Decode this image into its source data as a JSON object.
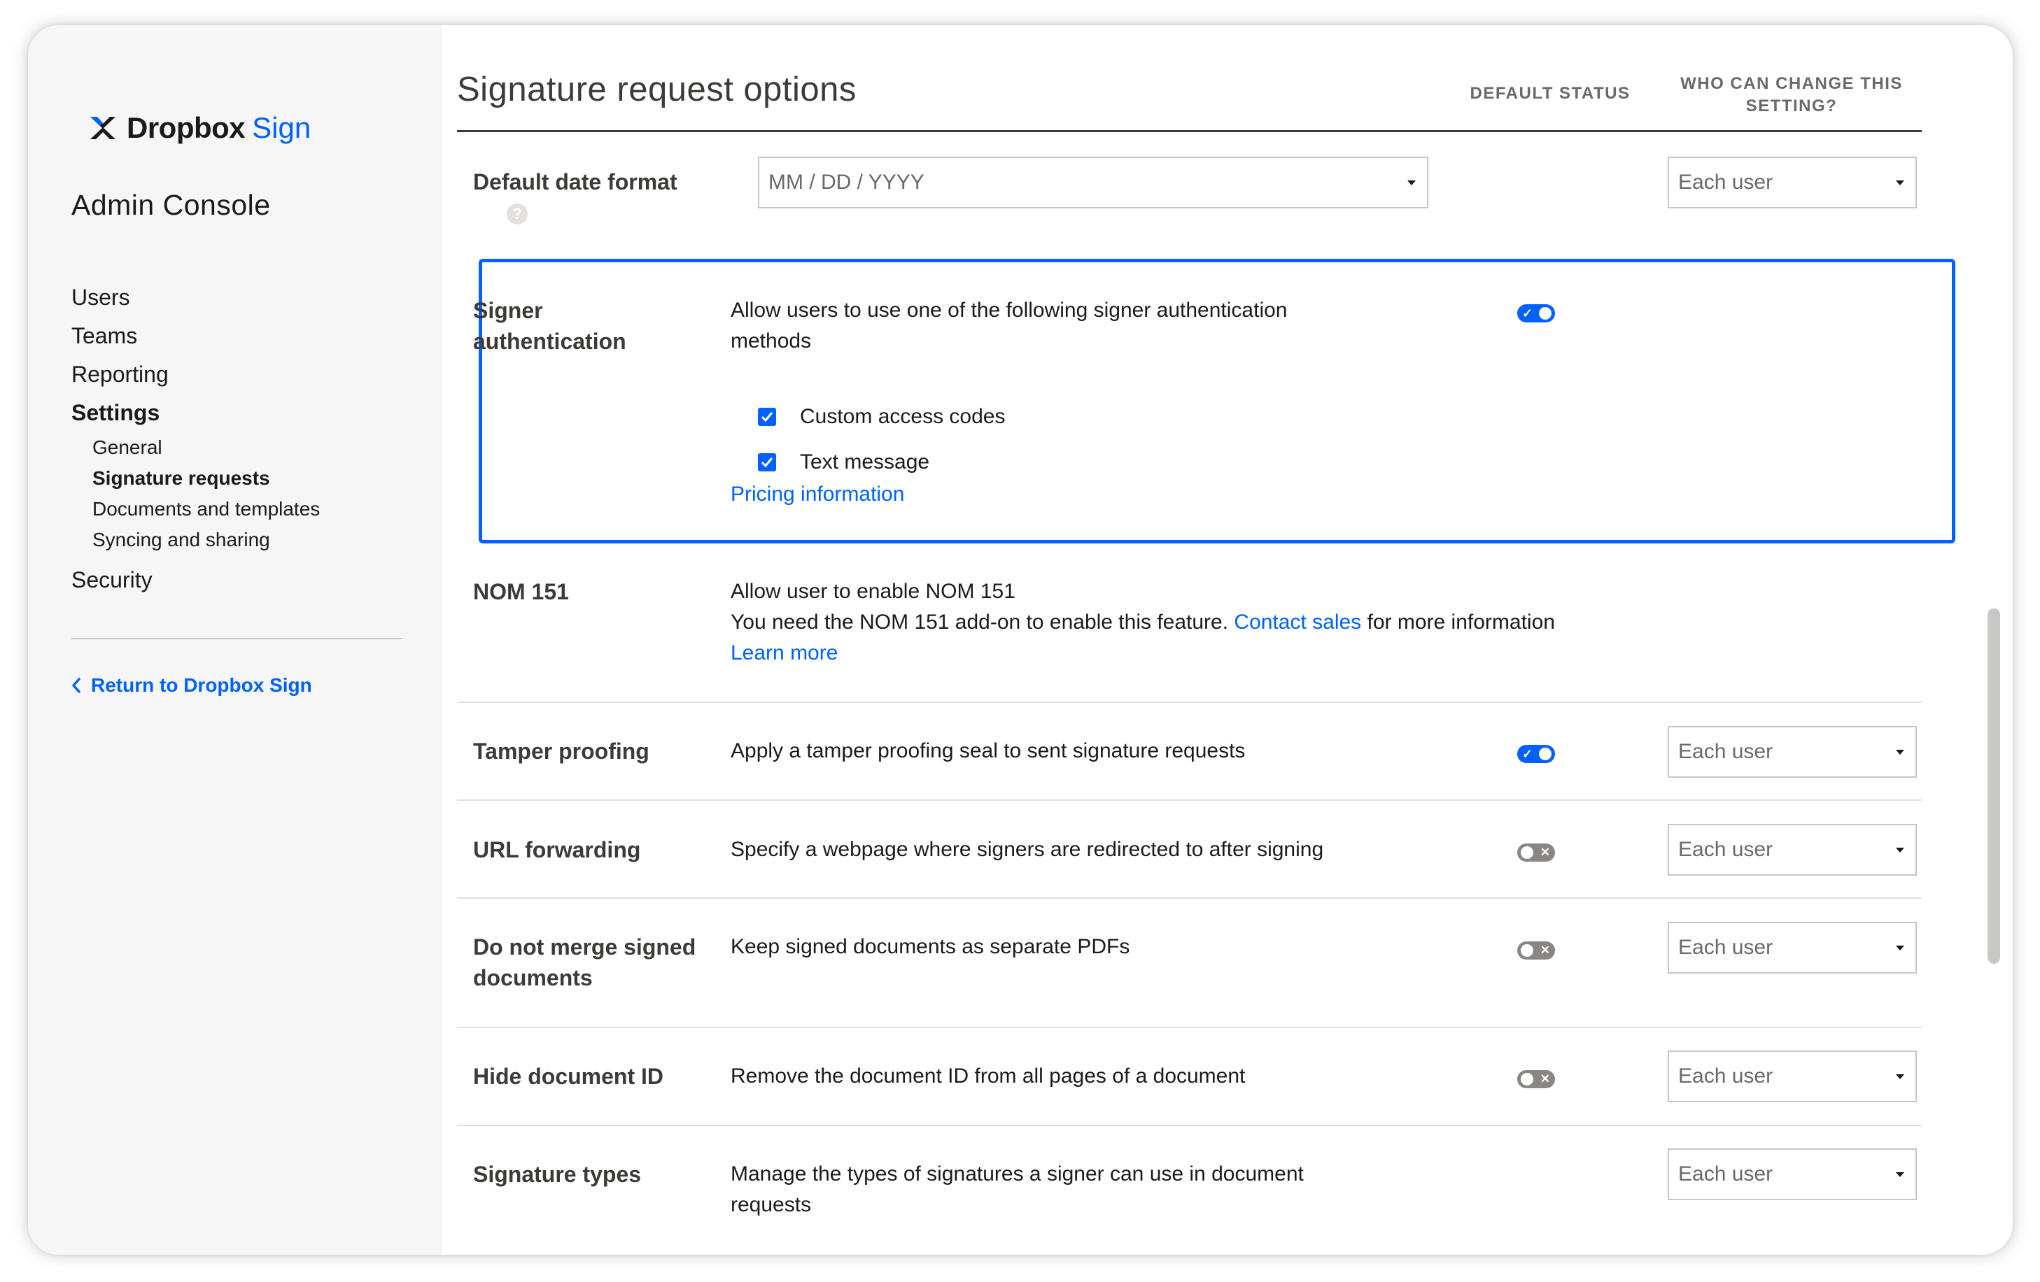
{
  "sidebar": {
    "logo_text": "Dropbox",
    "logo_accent": "Sign",
    "console_title": "Admin Console",
    "nav": [
      {
        "label": "Users"
      },
      {
        "label": "Teams"
      },
      {
        "label": "Reporting"
      },
      {
        "label": "Settings"
      }
    ],
    "settings_sub": [
      {
        "label": "General"
      },
      {
        "label": "Signature requests"
      },
      {
        "label": "Documents and templates"
      },
      {
        "label": "Syncing and sharing"
      }
    ],
    "security_label": "Security",
    "return_link": "Return to Dropbox Sign"
  },
  "main": {
    "title": "Signature request options",
    "col_default_status": "DEFAULT STATUS",
    "col_who_can_change": "WHO CAN CHANGE THIS SETTING?",
    "date_format": {
      "label": "Default date format",
      "help_icon": "?",
      "value": "MM / DD / YYYY",
      "who": "Each user"
    },
    "signer_auth": {
      "label": "Signer authentication",
      "desc": "Allow users to use one of the following signer authentication methods",
      "toggle_on": true,
      "options": [
        {
          "label": "Custom access codes",
          "checked": true
        },
        {
          "label": "Text message",
          "checked": true
        }
      ],
      "pricing_link": "Pricing information"
    },
    "nom151": {
      "label": "NOM 151",
      "line1": "Allow user to enable NOM 151",
      "line2_prefix": "You need the NOM 151 add-on to enable this feature.",
      "contact_link": "Contact sales",
      "line2_suffix": "for more information",
      "learn_more": "Learn more"
    },
    "rows": [
      {
        "label": "Tamper proofing",
        "desc": "Apply a tamper proofing seal to sent signature requests",
        "toggle_on": true,
        "who": "Each user"
      },
      {
        "label": "URL forwarding",
        "desc": "Specify a webpage where signers are redirected to after signing",
        "toggle_on": false,
        "who": "Each user"
      },
      {
        "label": "Do not merge signed documents",
        "desc": "Keep signed documents as separate PDFs",
        "toggle_on": false,
        "who": "Each user"
      },
      {
        "label": "Hide document ID",
        "desc": "Remove the document ID from all pages of a document",
        "toggle_on": false,
        "who": "Each user"
      },
      {
        "label": "Signature types",
        "desc": "Manage the types of signatures a signer can use in document requests",
        "who": "Each user"
      }
    ]
  }
}
